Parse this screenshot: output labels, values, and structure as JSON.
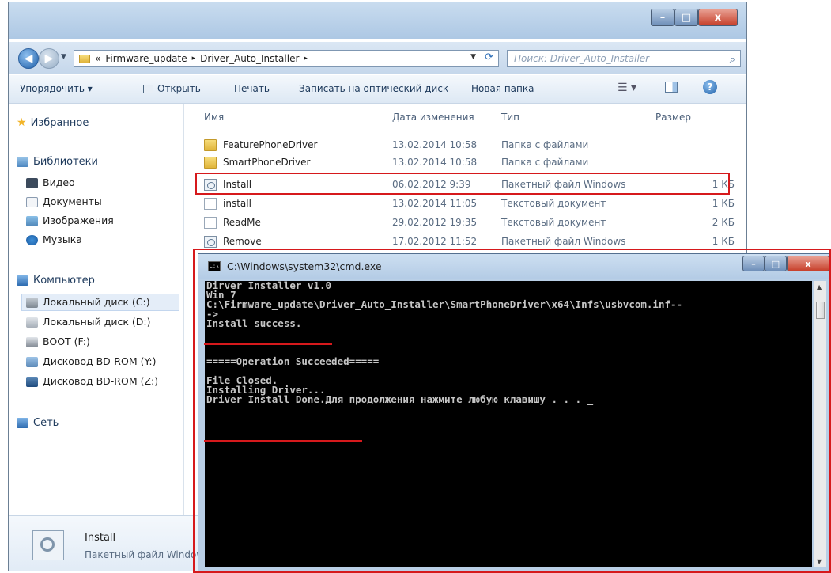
{
  "explorer": {
    "window_buttons": {
      "minimize": "–",
      "maximize": "□",
      "close": "x"
    },
    "address": {
      "overflow": "«",
      "crumbs": [
        "Firmware_update",
        "Driver_Auto_Installer"
      ],
      "separator": "▸"
    },
    "search_placeholder": "Поиск: Driver_Auto_Installer",
    "toolbar": {
      "organize": "Упорядочить ▾",
      "open": "Открыть",
      "print": "Печать",
      "burn": "Записать на оптический диск",
      "new_folder": "Новая папка"
    },
    "nav": {
      "favorites": "Избранное",
      "libraries": "Библиотеки",
      "library_items": [
        "Видео",
        "Документы",
        "Изображения",
        "Музыка"
      ],
      "computer": "Компьютер",
      "drives": [
        "Локальный диск (C:)",
        "Локальный диск (D:)",
        "BOOT (F:)",
        "Дисковод BD-ROM (Y:)",
        "Дисковод BD-ROM (Z:)"
      ],
      "network": "Сеть"
    },
    "columns": {
      "name": "Имя",
      "date": "Дата изменения",
      "type": "Тип",
      "size": "Размер"
    },
    "files": [
      {
        "name": "FeaturePhoneDriver",
        "date": "13.02.2014 10:58",
        "type": "Папка с файлами",
        "size": "",
        "icon": "folder-icon"
      },
      {
        "name": "SmartPhoneDriver",
        "date": "13.02.2014 10:58",
        "type": "Папка с файлами",
        "size": "",
        "icon": "folder-icon"
      },
      {
        "name": "Install",
        "date": "06.02.2012 9:39",
        "type": "Пакетный файл Windows",
        "size": "1 КБ",
        "icon": "batch-file-icon"
      },
      {
        "name": "install",
        "date": "13.02.2014 11:05",
        "type": "Текстовый документ",
        "size": "1 КБ",
        "icon": "text-file-icon"
      },
      {
        "name": "ReadMe",
        "date": "29.02.2012 19:35",
        "type": "Текстовый документ",
        "size": "2 КБ",
        "icon": "text-file-icon"
      },
      {
        "name": "Remove",
        "date": "17.02.2012 11:52",
        "type": "Пакетный файл Windows",
        "size": "1 КБ",
        "icon": "batch-file-icon"
      }
    ],
    "details": {
      "name": "Install",
      "type": "Пакетный файл Windows"
    }
  },
  "cmd": {
    "title": "C:\\Windows\\system32\\cmd.exe",
    "icon_text": "C:\\",
    "window_buttons": {
      "minimize": "–",
      "maximize": "□",
      "close": "x"
    },
    "lines": [
      "Dirver Installer v1.0",
      "Win 7",
      "C:\\Firmware_update\\Driver_Auto_Installer\\SmartPhoneDriver\\x64\\Infs\\usbvcom.inf--",
      "->",
      "Install success.",
      "",
      "",
      "",
      "=====Operation Succeeded=====",
      "",
      "File Closed.",
      "Installing Driver...",
      "Driver Install Done.Для продолжения нажмите любую клавишу . . . _"
    ]
  },
  "colors": {
    "highlight": "#d6191c",
    "console_bg": "#000000",
    "console_text": "#c6c6c6"
  }
}
